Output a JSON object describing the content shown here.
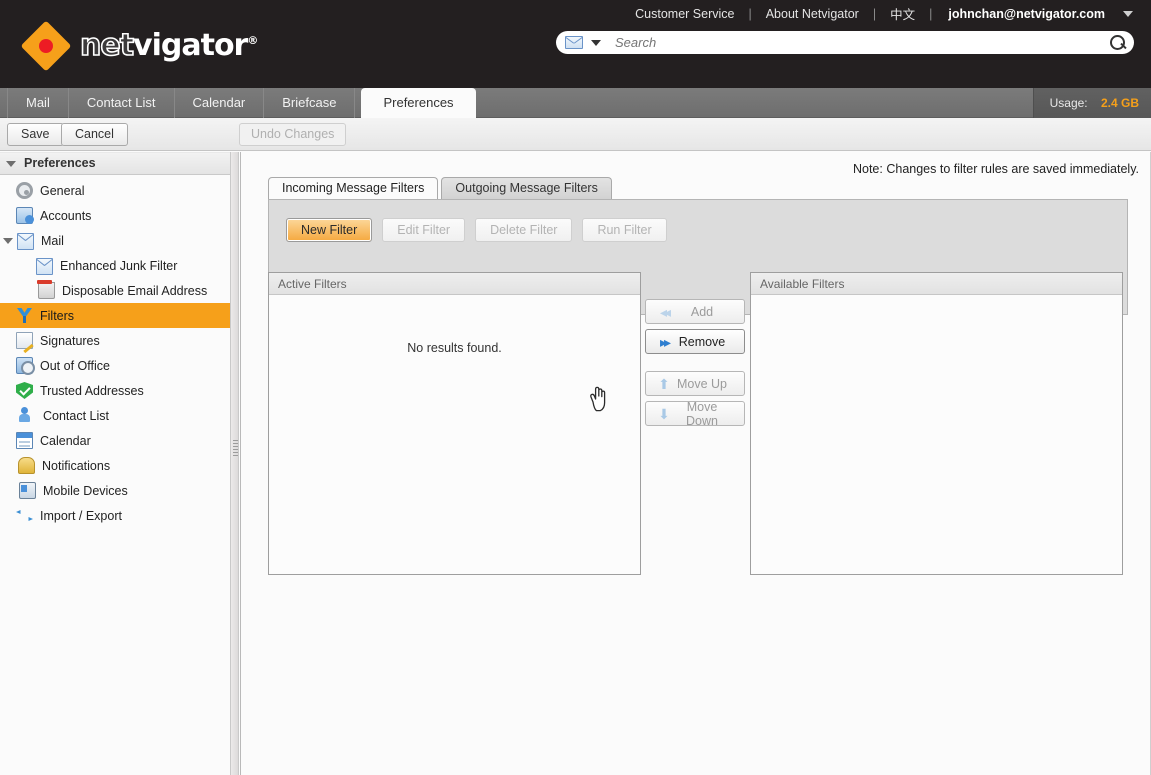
{
  "header": {
    "brand": "netvigator",
    "brand_part1": "net",
    "brand_part2": "vigator",
    "brand_reg": "®",
    "links": [
      {
        "label": "Customer Service",
        "name": "customer-service-link"
      },
      {
        "label": "About Netvigator",
        "name": "about-netvigator-link"
      },
      {
        "label": "中文",
        "name": "chinese-language-link"
      }
    ],
    "separator": "|",
    "user_email": "johnchan@netvigator.com",
    "search": {
      "placeholder": "Search",
      "value": ""
    }
  },
  "app_tabs": [
    {
      "label": "Mail",
      "active": false
    },
    {
      "label": "Contact List",
      "active": false
    },
    {
      "label": "Calendar",
      "active": false
    },
    {
      "label": "Briefcase",
      "active": false
    },
    {
      "label": "Preferences",
      "active": true
    }
  ],
  "usage": {
    "label": "Usage:",
    "value": "2.4 GB",
    "accent_color": "#f6a01a"
  },
  "toolbar": {
    "save_label": "Save",
    "cancel_label": "Cancel",
    "undo_label": "Undo Changes"
  },
  "sidebar": {
    "title": "Preferences",
    "items": [
      {
        "label": "General",
        "icon": "gear-icon",
        "level": 0,
        "selected": false
      },
      {
        "label": "Accounts",
        "icon": "accounts-icon",
        "level": 0,
        "selected": false
      },
      {
        "label": "Mail",
        "icon": "mail-envelope-icon",
        "level": 0,
        "selected": false,
        "expandable": true
      },
      {
        "label": "Enhanced Junk Filter",
        "icon": "junk-envelope-icon",
        "level": 1,
        "selected": false
      },
      {
        "label": "Disposable Email Address",
        "icon": "trash-icon",
        "level": 1,
        "selected": false
      },
      {
        "label": "Filters",
        "icon": "filter-branch-icon",
        "level": 0,
        "selected": true
      },
      {
        "label": "Signatures",
        "icon": "signature-pencil-icon",
        "level": 0,
        "selected": false
      },
      {
        "label": "Out of Office",
        "icon": "out-of-office-clock-icon",
        "level": 0,
        "selected": false
      },
      {
        "label": "Trusted Addresses",
        "icon": "shield-check-icon",
        "level": 0,
        "selected": false
      },
      {
        "label": "Contact List",
        "icon": "contact-person-icon",
        "level": 0,
        "selected": false
      },
      {
        "label": "Calendar",
        "icon": "calendar-icon",
        "level": 0,
        "selected": false
      },
      {
        "label": "Notifications",
        "icon": "bell-icon",
        "level": 0,
        "selected": false
      },
      {
        "label": "Mobile Devices",
        "icon": "mobile-phone-icon",
        "level": 0,
        "selected": false
      },
      {
        "label": "Import / Export",
        "icon": "import-export-arrows-icon",
        "level": 0,
        "selected": false
      }
    ]
  },
  "content": {
    "note": "Note: Changes to filter rules are saved immediately.",
    "sub_tabs": [
      {
        "label": "Incoming Message Filters",
        "active": true
      },
      {
        "label": "Outgoing Message Filters",
        "active": false
      }
    ],
    "filter_buttons": [
      {
        "label": "New Filter",
        "state": "primary"
      },
      {
        "label": "Edit Filter",
        "state": "disabled"
      },
      {
        "label": "Delete Filter",
        "state": "disabled"
      },
      {
        "label": "Run Filter",
        "state": "disabled"
      }
    ],
    "active_filters": {
      "title": "Active Filters",
      "empty_text": "No results found.",
      "rows": []
    },
    "available_filters": {
      "title": "Available Filters",
      "empty_text": "",
      "rows": []
    },
    "transfer_buttons": [
      {
        "label": "Add",
        "icon": "double-chevron-left-icon",
        "state": "disabled"
      },
      {
        "label": "Remove",
        "icon": "double-chevron-right-icon",
        "state": "enabled"
      },
      {
        "label": "Move Up",
        "icon": "arrow-up-icon",
        "state": "disabled"
      },
      {
        "label": "Move Down",
        "icon": "arrow-down-icon",
        "state": "disabled"
      }
    ]
  }
}
